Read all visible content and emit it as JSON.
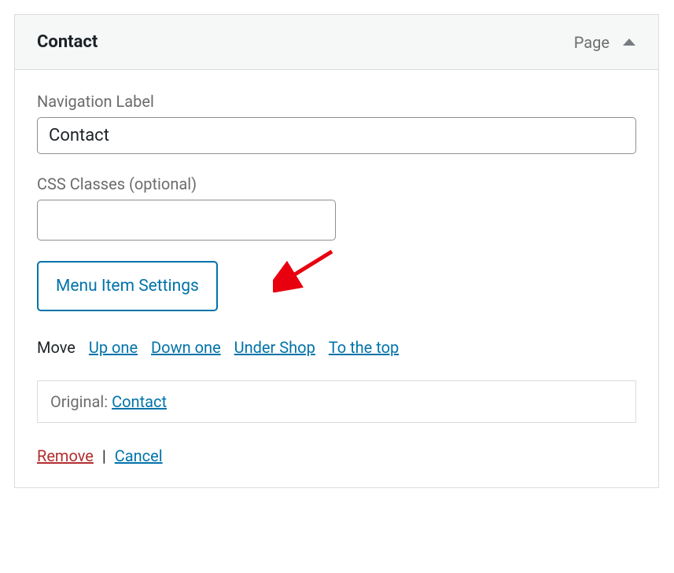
{
  "header": {
    "title": "Contact",
    "item_type": "Page"
  },
  "fields": {
    "navigation_label": {
      "label": "Navigation Label",
      "value": "Contact"
    },
    "css_classes": {
      "label": "CSS Classes (optional)",
      "value": ""
    }
  },
  "buttons": {
    "settings": "Menu Item Settings"
  },
  "move": {
    "label": "Move",
    "up_one": "Up one",
    "down_one": "Down one",
    "under_shop": "Under Shop",
    "to_the_top": "To the top"
  },
  "original": {
    "label": "Original:",
    "link_text": "Contact"
  },
  "actions": {
    "remove": "Remove",
    "separator": "|",
    "cancel": "Cancel"
  }
}
